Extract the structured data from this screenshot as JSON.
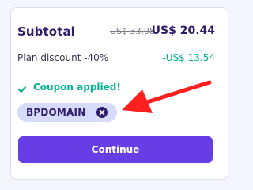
{
  "summary": {
    "subtotal_label": "Subtotal",
    "original_price": "US$ 33.98",
    "final_price": "US$ 20.44",
    "discount_label": "Plan discount -40%",
    "discount_value": "-US$ 13.54"
  },
  "coupon": {
    "status_text": "Coupon applied!",
    "code": "BPDOMAIN",
    "status_icon": "check-icon",
    "remove_icon": "close-icon"
  },
  "actions": {
    "continue_label": "Continue"
  },
  "colors": {
    "primary": "#673de6",
    "text_dark": "#2f1c6a",
    "success": "#00b090",
    "chip_background": "#d7dbfb",
    "annotation_arrow": "#ff1f1f"
  }
}
